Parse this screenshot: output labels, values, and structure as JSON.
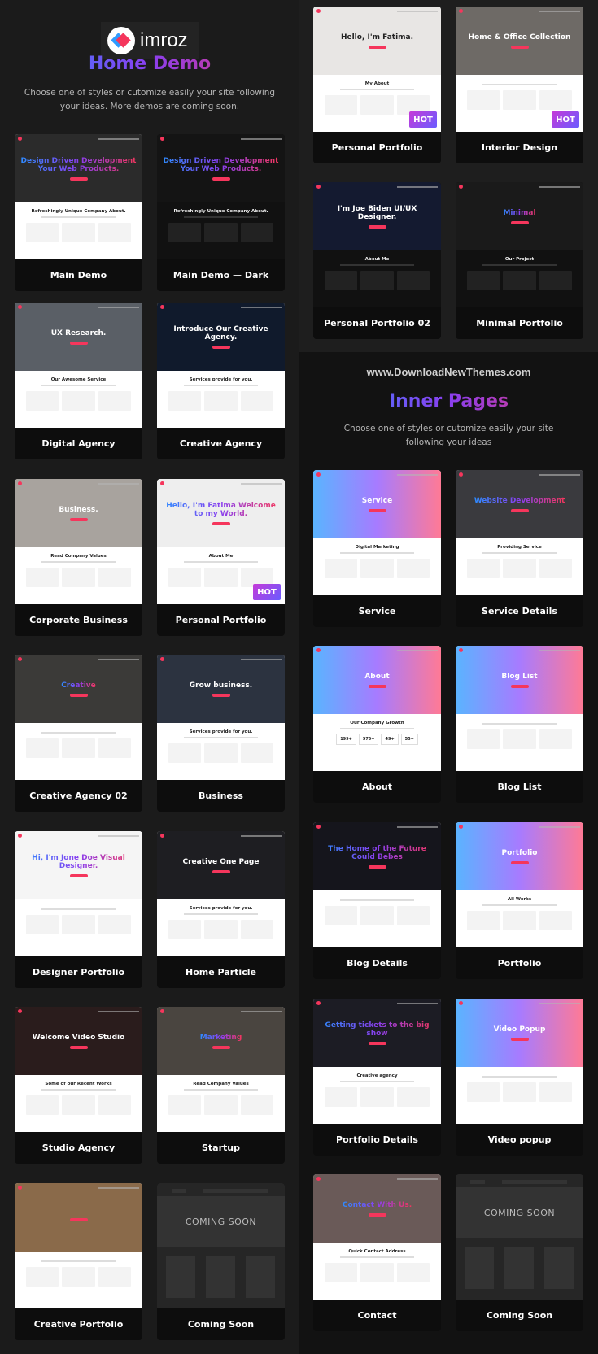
{
  "brand": {
    "logo_text": "imroz"
  },
  "home": {
    "title": "Home Demo",
    "subtitle_1": "Choose one of styles or cutomize easily your site following",
    "subtitle_2": "your ideas. More demos are coming soon."
  },
  "watermark": "www.DownloadNewThemes.com",
  "inner": {
    "title": "Inner Pages",
    "subtitle_1": "Choose one of styles or cutomize easily your site",
    "subtitle_2": "following your ideas"
  },
  "colors": {
    "accent": "#f5365c",
    "gradient_start": "#2d8cff",
    "gradient_mid": "#8a3ff0",
    "background": "#1b1b1b",
    "card_label_bg": "#0d0d0d"
  },
  "hot_label": "HOT",
  "home_demos": [
    {
      "label": "Main Demo",
      "hero_title": "Design Driven Development Your Web Products.",
      "section_title": "Refreshingly Unique Company About.",
      "hero_bg": "#2b2b2b",
      "gradient": true
    },
    {
      "label": "Main Demo — Dark",
      "hero_title": "Design Driven Development Your Web Products.",
      "section_title": "Refreshingly Unique Company About.",
      "hero_bg": "#141414",
      "gradient": true,
      "dark": true
    },
    {
      "label": "Digital Agency",
      "hero_title": "UX Research.",
      "section_title": "Our Awesome Service",
      "hero_bg": "#5a5f66"
    },
    {
      "label": "Creative Agency",
      "hero_title": "Introduce Our Creative Agency.",
      "section_title": "Services provide for you.",
      "hero_bg": "#101a2c"
    },
    {
      "label": "Corporate Business",
      "hero_title": "Business.",
      "section_title": "Read Company Values",
      "hero_bg": "#a8a39e"
    },
    {
      "label": "Personal Portfolio",
      "hero_title": "Hello, I'm Fatima Welcome to my World.",
      "section_title": "About Me",
      "hero_bg": "#eeeeee",
      "gradient": true,
      "hot": true
    },
    {
      "label": "Creative Agency 02",
      "hero_title": "Creative",
      "section_title": "",
      "hero_bg": "#3b3a38",
      "gradient": true
    },
    {
      "label": "Business",
      "hero_title": "Grow business.",
      "section_title": "Services provide for you.",
      "hero_bg": "#2c3340"
    },
    {
      "label": "Designer Portfolio",
      "hero_title": "Hi, I'm Jone Doe Visual Designer.",
      "section_title": "",
      "hero_bg": "#f5f5f5",
      "gradient": true
    },
    {
      "label": "Home Particle",
      "hero_title": "Creative One Page",
      "section_title": "Services provide for you.",
      "hero_bg": "#1e1e22"
    },
    {
      "label": "Studio Agency",
      "hero_title": "Welcome Video Studio",
      "section_title": "Some of our Recent Works",
      "hero_bg": "#2a1c1c"
    },
    {
      "label": "Startup",
      "hero_title": "Marketing",
      "section_title": "Read Company Values",
      "hero_bg": "#4a4540",
      "gradient": true
    },
    {
      "label": "Creative Portfolio",
      "hero_title": "",
      "section_title": "",
      "hero_bg": "#8a6a4a"
    },
    {
      "label": "Coming Soon",
      "coming_soon": "COMING SOON"
    }
  ],
  "featured": [
    {
      "label": "Personal Portfolio",
      "hero_title": "Hello, I'm Fatima.",
      "section_title": "My About",
      "hero_bg": "#e8e6e4",
      "hot": true
    },
    {
      "label": "Interior Design",
      "hero_title": "Home & Office Collection",
      "section_title": "",
      "hero_bg": "#6e6a66",
      "hot": true
    },
    {
      "label": "Personal Portfolio 02",
      "hero_title": "I'm Joe Biden UI/UX Designer.",
      "section_title": "About Me",
      "hero_bg": "#141a30",
      "dark": true
    },
    {
      "label": "Minimal Portfolio",
      "hero_title": "Minimal",
      "section_title": "Our Project",
      "hero_bg": "#1a1a1a",
      "gradient": true,
      "dark": true
    }
  ],
  "inner_pages": [
    {
      "label": "Service",
      "hero_title": "Service",
      "section_title": "Digital Marketing",
      "hero_bg": "linear-gradient(90deg,#5ab4ff,#a77bff,#ff7a95)"
    },
    {
      "label": "Service Details",
      "hero_title": "Website Development",
      "section_title": "Providing Service",
      "hero_bg": "#3a3a3e",
      "gradient": true
    },
    {
      "label": "About",
      "hero_title": "About",
      "section_title": "Our Company Growth",
      "hero_bg": "linear-gradient(90deg,#5ab4ff,#a77bff,#ff7a95)",
      "stats": [
        "199+",
        "575+",
        "49+",
        "55+"
      ]
    },
    {
      "label": "Blog List",
      "hero_title": "Blog List",
      "section_title": "",
      "hero_bg": "linear-gradient(90deg,#5ab4ff,#a77bff,#ff7a95)"
    },
    {
      "label": "Blog Details",
      "hero_title": "The Home of the Future Could Bebes",
      "section_title": "",
      "hero_bg": "#15151c",
      "gradient": true
    },
    {
      "label": "Portfolio",
      "hero_title": "Portfolio",
      "section_title": "All Works",
      "hero_bg": "linear-gradient(90deg,#5ab4ff,#a77bff,#ff7a95)"
    },
    {
      "label": "Portfolio Details",
      "hero_title": "Getting tickets to the big show",
      "section_title": "Creative agency",
      "hero_bg": "#1c1c24",
      "gradient": true
    },
    {
      "label": "Video popup",
      "hero_title": "Video Popup",
      "section_title": "",
      "hero_bg": "linear-gradient(90deg,#5ab4ff,#a77bff,#ff7a95)"
    },
    {
      "label": "Contact",
      "hero_title": "Contact With Us.",
      "section_title": "Quick Contact Address",
      "hero_bg": "#6a5a58",
      "gradient": true
    },
    {
      "label": "Coming Soon",
      "coming_soon": "COMING SOON"
    }
  ]
}
